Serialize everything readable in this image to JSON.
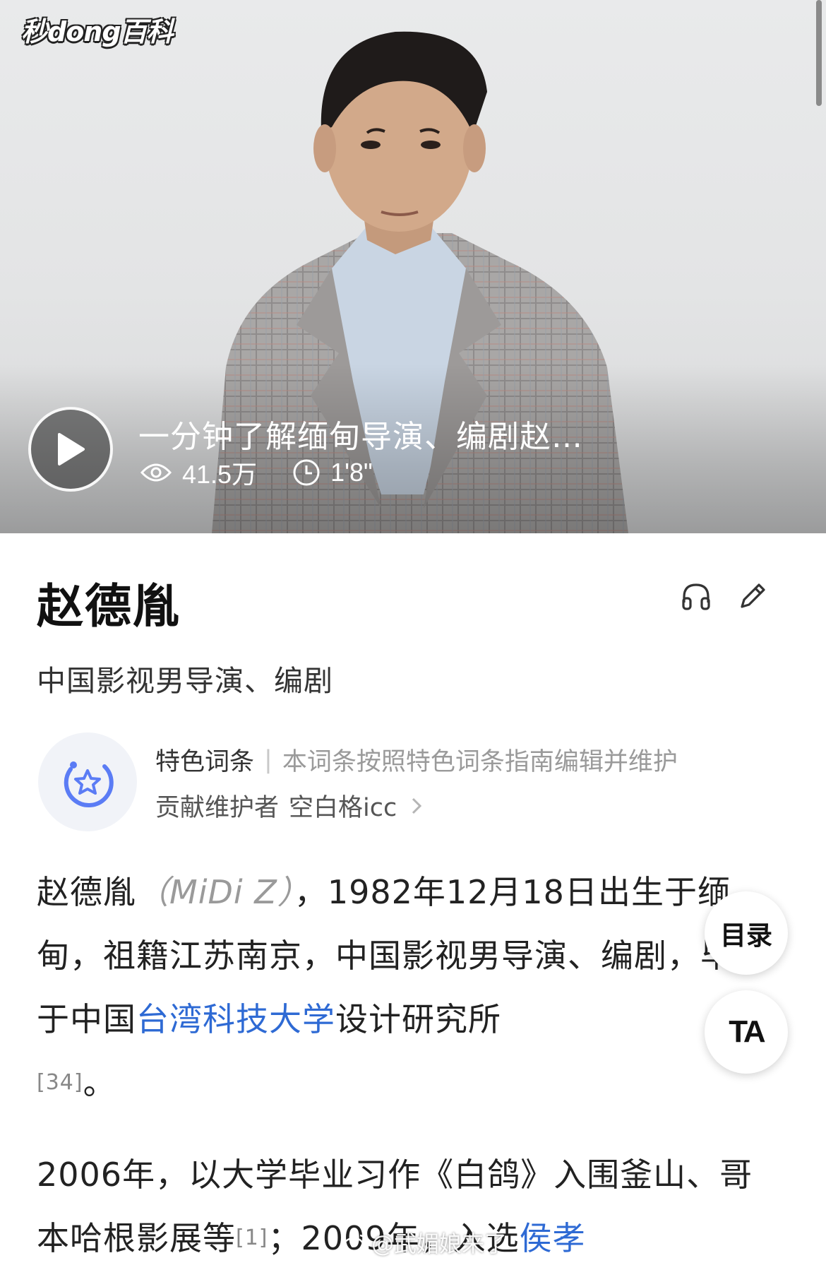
{
  "video": {
    "brand": "秒dong百科",
    "title": "一分钟了解缅甸导演、编剧赵…",
    "views": "41.5万",
    "duration": "1'8\""
  },
  "entry": {
    "title": "赵德胤",
    "subtitle": "中国影视男导演、编剧"
  },
  "feature": {
    "label": "特色词条",
    "description": "本词条按照特色词条指南编辑并维护",
    "maintainer_label": "贡献维护者",
    "maintainer_name": "空白格icc"
  },
  "body": {
    "p1": {
      "name": "赵德胤",
      "alias": "（MiDi Z）",
      "text1": "，1982年12月18日出生于缅甸，祖籍江苏南京，中国影视男导演、编剧，毕业于中国",
      "link": "台湾科技大学",
      "text2": "设计研究所",
      "cite": "[34]",
      "end": "。"
    },
    "p2": {
      "text1": "2006年，以大学毕业习作《白鸽》入围釜山、哥本哈根影展等",
      "cite": "[1]",
      "text2": "；2009年，入选",
      "link": "侯孝"
    }
  },
  "floating": {
    "toc": "目录",
    "ta": "TA"
  },
  "watermark": "@武媚娘来了"
}
